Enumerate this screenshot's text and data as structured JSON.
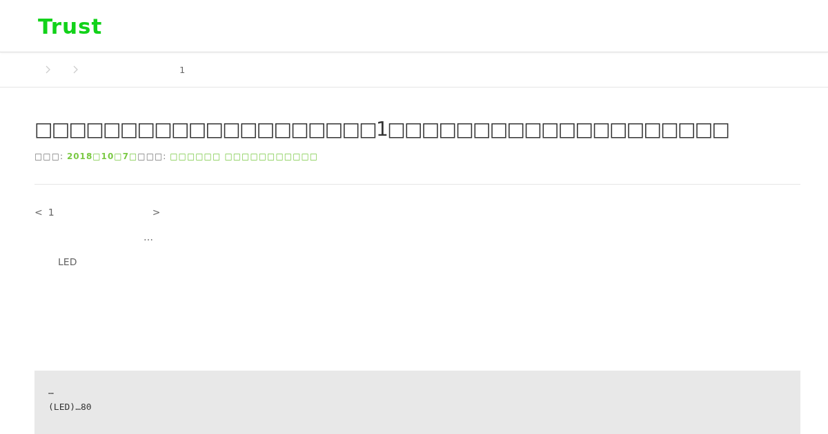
{
  "header": {
    "logo": "Trust"
  },
  "breadcrumb": {
    "current": "1"
  },
  "article": {
    "title": "□□□□□□□□□□□□□□□□□□□□1□□□□□□□□□□□□□□□□□□□□",
    "meta": [
      {
        "label": "□□□: ",
        "value": "2018□10□7□"
      },
      {
        "label": "□□□: ",
        "value": "□□□□□□ □□□□□□□□□□□"
      }
    ],
    "pager": {
      "prev": "<",
      "number": "1",
      "next": ">"
    },
    "paragraphs": [
      "…",
      "LED"
    ],
    "code_lines": [
      "…",
      "(LED)…80"
    ]
  }
}
